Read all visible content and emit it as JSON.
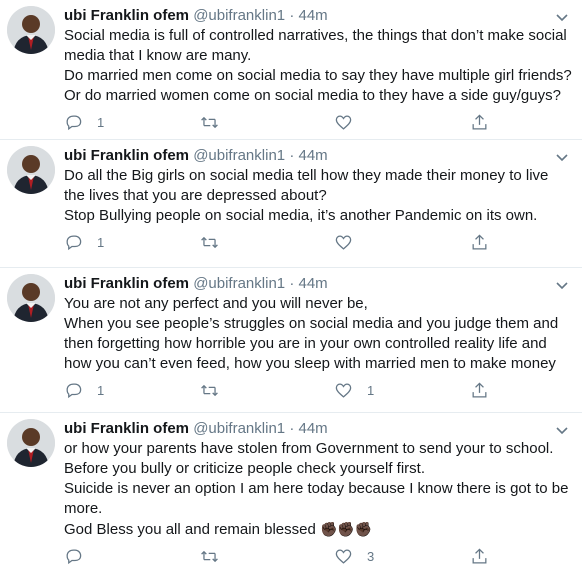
{
  "tweets": [
    {
      "name": "ubi Franklin ofem",
      "handle": "@ubifranklin1",
      "time": "44m",
      "text": "Social media is full of controlled narratives, the things that don’t make social media that I know are many.\nDo married men come on social media to say they have multiple girl friends?\nOr do married women come on social media to they have a side guy/guys?",
      "replies": "1",
      "retweets": "",
      "likes": ""
    },
    {
      "name": "ubi Franklin ofem",
      "handle": "@ubifranklin1",
      "time": "44m",
      "text": "Do all the Big girls on social media tell how they made their money to live the lives that you are depressed about?\nStop Bullying people on social media, it’s another Pandemic on its own.",
      "replies": "1",
      "retweets": "",
      "likes": ""
    },
    {
      "name": "ubi Franklin ofem",
      "handle": "@ubifranklin1",
      "time": "44m",
      "text": "You are not any perfect and you will never be,\nWhen you see people’s struggles on social media and you judge them and then forgetting how horrible you are in your own controlled reality life and how you can’t even feed, how you sleep with married men to make money",
      "replies": "1",
      "retweets": "",
      "likes": "1"
    },
    {
      "name": "ubi Franklin ofem",
      "handle": "@ubifranklin1",
      "time": "44m",
      "text": "or how your parents have stolen from Government to send your to school.\nBefore you bully or criticize people check yourself first.\nSuicide is never an option I am here today because I know there is got to be more.\nGod Bless you all and remain blessed",
      "emoji": "✊🏿✊🏿✊🏿",
      "replies": "",
      "retweets": "",
      "likes": "3"
    }
  ],
  "separator": "·",
  "icons": {
    "reply": "reply-icon",
    "retweet": "retweet-icon",
    "like": "heart-icon",
    "share": "share-icon",
    "menu": "chevron-down-icon"
  },
  "colors": {
    "text": "#14171a",
    "muted": "#657786",
    "border": "#e6ecf0"
  }
}
